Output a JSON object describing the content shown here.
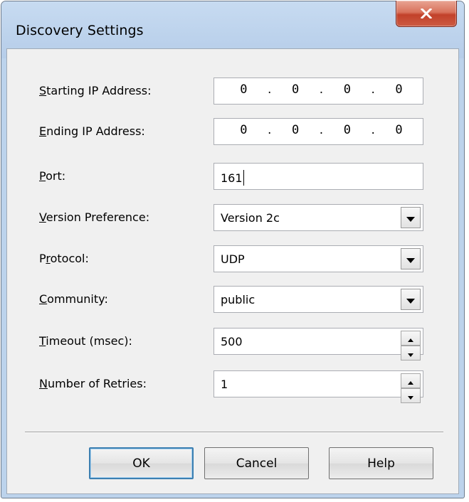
{
  "window": {
    "title": "Discovery Settings",
    "close_label": "X"
  },
  "fields": {
    "start_ip": {
      "label_u": "S",
      "label_rest": "tarting IP Address:",
      "octets": [
        "0",
        "0",
        "0",
        "0"
      ]
    },
    "end_ip": {
      "label_u": "E",
      "label_rest": "nding IP Address:",
      "octets": [
        "0",
        "0",
        "0",
        "0"
      ]
    },
    "port": {
      "label_u": "P",
      "label_rest": "ort:",
      "value": "161"
    },
    "version": {
      "label_u": "V",
      "label_rest": "ersion Preference:",
      "value": "Version 2c"
    },
    "protocol": {
      "label_pre": "P",
      "label_u": "r",
      "label_rest": "otocol:",
      "value": "UDP"
    },
    "community": {
      "label_u": "C",
      "label_rest": "ommunity:",
      "value": "public"
    },
    "timeout": {
      "label_u": "T",
      "label_rest": "imeout (msec):",
      "value": "500"
    },
    "retries": {
      "label_u": "N",
      "label_rest": "umber of Retries:",
      "value": "1"
    }
  },
  "ip_separator": ".",
  "buttons": {
    "ok": "OK",
    "cancel": "Cancel",
    "help": "Help"
  },
  "icons": {
    "close": "close-icon",
    "dropdown": "chevron-down-icon",
    "spin_up": "spin-up-icon",
    "spin_down": "spin-down-icon"
  },
  "colors": {
    "titlebar": "#bcd3ec",
    "client": "#f0f0f0",
    "close_button": "#c2412a",
    "default_button_border": "#3c7fb1"
  }
}
